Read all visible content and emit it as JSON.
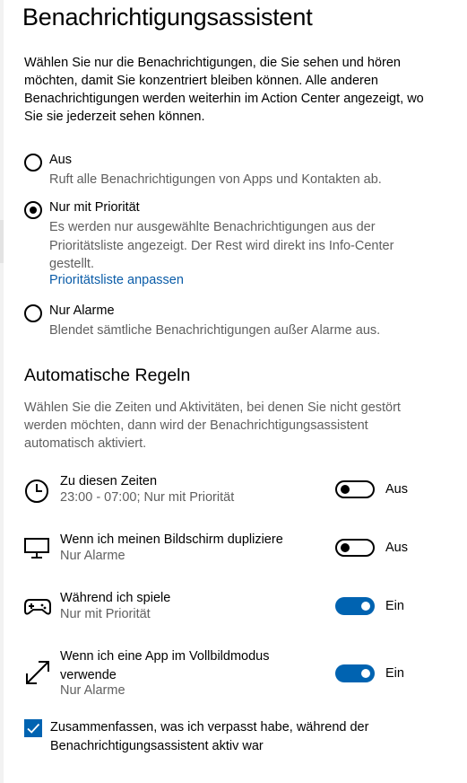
{
  "page": {
    "title": "Benachrichtigungsassistent",
    "intro": "Wählen Sie nur die Benachrichtigungen, die Sie sehen und hören möchten, damit Sie konzentriert bleiben können. Alle anderen Benachrichtigungen werden weiterhin im Action Center angezeigt, wo Sie sie jederzeit sehen können."
  },
  "modes": [
    {
      "label": "Aus",
      "description": "Ruft alle Benachrichtigungen von Apps und Kontakten ab.",
      "selected": false
    },
    {
      "label": "Nur mit Priorität",
      "description": "Es werden nur ausgewählte Benachrichtigungen aus der Prioritätsliste angezeigt. Der Rest wird direkt ins Info-Center gestellt.",
      "link": "Prioritätsliste anpassen",
      "selected": true
    },
    {
      "label": "Nur Alarme",
      "description": "Blendet sämtliche Benachrichtigungen außer Alarme aus.",
      "selected": false
    }
  ],
  "rules": {
    "heading": "Automatische Regeln",
    "description": "Wählen Sie die Zeiten und Aktivitäten, bei denen Sie nicht gestört werden möchten, dann wird der Benachrichtigungsassistent automatisch aktiviert.",
    "items": [
      {
        "icon": "clock-icon",
        "title": "Zu diesen Zeiten",
        "subtitle": "23:00 - 07:00; Nur mit Priorität",
        "on": false,
        "state": "Aus"
      },
      {
        "icon": "monitor-icon",
        "title": "Wenn ich meinen Bildschirm dupliziere",
        "subtitle": "Nur Alarme",
        "on": false,
        "state": "Aus"
      },
      {
        "icon": "gamepad-icon",
        "title": "Während ich spiele",
        "subtitle": "Nur mit Priorität",
        "on": true,
        "state": "Ein"
      },
      {
        "icon": "fullscreen-icon",
        "title": "Wenn ich eine App im Vollbildmodus verwende",
        "subtitle": "Nur Alarme",
        "on": true,
        "state": "Ein"
      }
    ]
  },
  "summary": {
    "label": "Zusammenfassen, was ich verpasst habe, während der Benachrichtigungsassistent aktiv war",
    "checked": true
  },
  "colors": {
    "accent": "#0063b1",
    "link": "#0a5ca8",
    "secondary_text": "#5f5f5f"
  }
}
